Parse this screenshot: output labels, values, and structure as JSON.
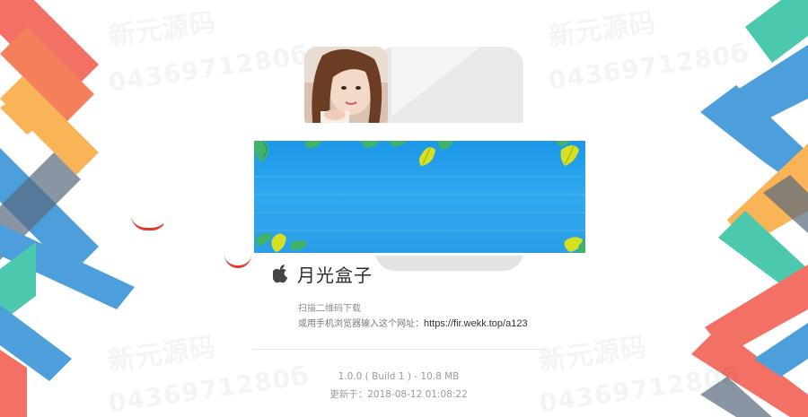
{
  "app": {
    "name": "月光盒子",
    "platform_icon": "apple-icon"
  },
  "download": {
    "scan_label": "扫描二维码下载",
    "browser_hint": "或用手机浏览器输入这个网址：",
    "url": "https://fir.wekk.top/a123"
  },
  "release": {
    "version_line": "1.0.0 ( Build 1 ) - 10.8 MB",
    "updated_line": "更新于：2018-08-12 01:08:22"
  },
  "watermark": {
    "numbers": "0436971280б",
    "text": "新元源码"
  },
  "colors": {
    "stripe_red": "#f2584a",
    "stripe_orange": "#f7a83a",
    "stripe_blue": "#2f8fd6",
    "stripe_teal": "#2cbfa0",
    "banner_blue": "#2aa6ef",
    "leaf_yellow": "#d6e022",
    "leaf_green": "#3fb36b"
  }
}
